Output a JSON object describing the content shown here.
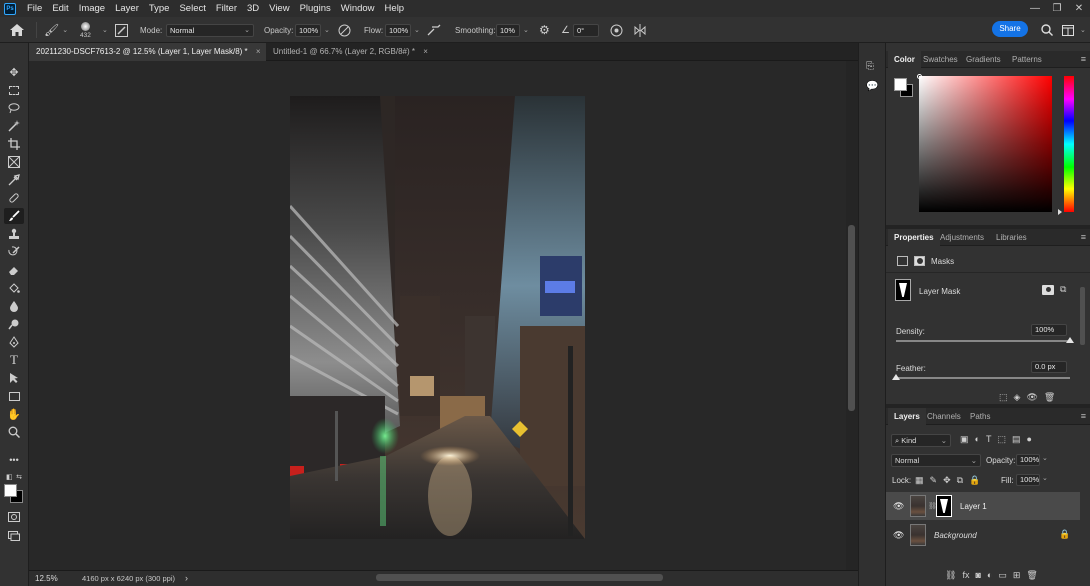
{
  "menu": {
    "logo": "Ps",
    "items": [
      "File",
      "Edit",
      "Image",
      "Layer",
      "Type",
      "Select",
      "Filter",
      "3D",
      "View",
      "Plugins",
      "Window",
      "Help"
    ]
  },
  "options": {
    "brush_size": "432",
    "mode_label": "Mode:",
    "mode_value": "Normal",
    "opacity_label": "Opacity:",
    "opacity_value": "100%",
    "flow_label": "Flow:",
    "flow_value": "100%",
    "smoothing_label": "Smoothing:",
    "smoothing_value": "10%",
    "angle_value": "0°",
    "share_label": "Share"
  },
  "tabs": [
    {
      "label": "20211230-DSCF7613-2 @ 12.5% (Layer 1, Layer Mask/8) *",
      "close": "×"
    },
    {
      "label": "Untitled-1 @ 66.7% (Layer 2, RGB/8#) *",
      "close": "×"
    }
  ],
  "status": {
    "zoom": "12.5%",
    "doc_info": "4160 px x 6240 px (300 ppi)",
    "arrow": "›"
  },
  "color_panel": {
    "tabs": [
      "Color",
      "Swatches",
      "Gradients",
      "Patterns"
    ]
  },
  "properties_panel": {
    "tabs": [
      "Properties",
      "Adjustments",
      "Libraries"
    ],
    "masks_label": "Masks",
    "layer_mask_label": "Layer Mask",
    "density_label": "Density:",
    "density_value": "100%",
    "density_level": 1.0,
    "feather_label": "Feather:",
    "feather_value": "0.0 px",
    "feather_level": 0.0
  },
  "layers_panel": {
    "tabs": [
      "Layers",
      "Channels",
      "Paths"
    ],
    "filter_label": "Kind",
    "blend_mode": "Normal",
    "opacity_label": "Opacity:",
    "opacity_value": "100%",
    "lock_label": "Lock:",
    "fill_label": "Fill:",
    "fill_value": "100%",
    "layers": [
      {
        "name": "Layer 1",
        "visible": true,
        "selected": true
      },
      {
        "name": "Background",
        "visible": true,
        "locked": true
      }
    ]
  },
  "colors": {
    "accent": "#1473e6",
    "foreground": "#ffffff",
    "background": "#000000"
  }
}
